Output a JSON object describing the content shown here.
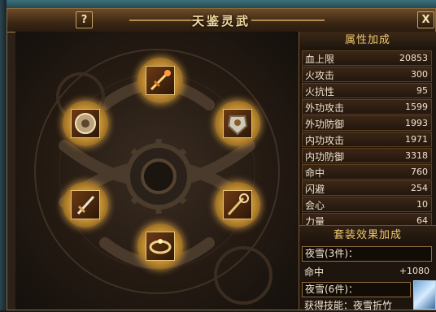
{
  "window": {
    "title": "天鉴灵武",
    "help_label": "?",
    "close_label": "X"
  },
  "equipment_slots": [
    {
      "name": "sword",
      "icon": "flaming-blade-icon"
    },
    {
      "name": "shield",
      "icon": "gear-shield-icon"
    },
    {
      "name": "armor",
      "icon": "armor-icon"
    },
    {
      "name": "dagger",
      "icon": "dagger-icon"
    },
    {
      "name": "staff",
      "icon": "golden-staff-icon"
    },
    {
      "name": "ring",
      "icon": "ring-icon"
    }
  ],
  "attributes": {
    "header": "属性加成",
    "rows": [
      {
        "label": "血上限",
        "value": "20853"
      },
      {
        "label": "火攻击",
        "value": "300"
      },
      {
        "label": "火抗性",
        "value": "95"
      },
      {
        "label": "外功攻击",
        "value": "1599"
      },
      {
        "label": "外功防御",
        "value": "1993"
      },
      {
        "label": "内功攻击",
        "value": "1971"
      },
      {
        "label": "内功防御",
        "value": "3318"
      },
      {
        "label": "命中",
        "value": "760"
      },
      {
        "label": "闪避",
        "value": "254"
      },
      {
        "label": "会心",
        "value": "10"
      },
      {
        "label": "力量",
        "value": "64"
      }
    ]
  },
  "set_bonus": {
    "header": "套装效果加成",
    "set1": "夜雪(3件)：",
    "set1_stat_label": "命中",
    "set1_stat_value": "+1080",
    "set2": "夜雪(6件)：",
    "set2_skill": "获得技能：夜雪折竹"
  },
  "colors": {
    "accent": "#f0c66c",
    "frame": "#8a6a3c"
  }
}
